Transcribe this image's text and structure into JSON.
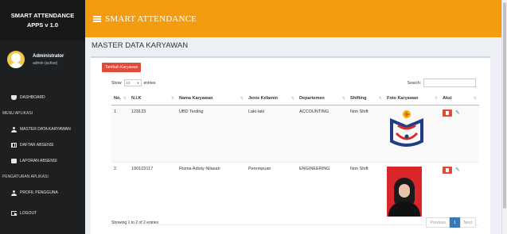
{
  "sidebar": {
    "brand_line1": "SMART ATTENDANCE",
    "brand_line2": "APPS v 1.0",
    "user_name": "Administrator",
    "user_status": "admin (active)",
    "items": [
      {
        "label": "DASHBOARD",
        "icon": "dashboard-icon"
      },
      {
        "label": "MENU APLIKASI",
        "header": true
      },
      {
        "label": "MASTER DATA KARYAWAN",
        "icon": "users-icon"
      },
      {
        "label": "DAFTAR ABSENSI",
        "icon": "table-icon"
      },
      {
        "label": "LAPORAN ABSENSI",
        "icon": "book-icon"
      },
      {
        "label": "PENGATURAN APLIKASI",
        "header": true
      },
      {
        "label": "PROFIL PENGGUNA",
        "icon": "user-icon"
      },
      {
        "label": "LOGOUT",
        "icon": "sign-out-icon"
      }
    ]
  },
  "topbar": {
    "title": "SMART ATTENDANCE"
  },
  "page": {
    "title": "MASTER DATA KARYAWAN"
  },
  "toolbar": {
    "add_label": "Tambah Karyawan",
    "show_label": "Show",
    "entries_value": "10",
    "entries_label": "entries",
    "search_label": "Search:"
  },
  "table": {
    "headers": [
      "No.",
      "N.I.K",
      "Nama Karyawan",
      "Jenis Kelamin",
      "Departemen",
      "Shifting",
      "Foto Karyawan",
      "Aksi"
    ],
    "rows": [
      {
        "no": "1",
        "nik": "123123",
        "nama": "UBD Testing",
        "jk": "Laki-laki",
        "dept": "ACCOUNTING",
        "shift": "Non Shift",
        "photo": "logo"
      },
      {
        "no": "2",
        "nik": "190103117",
        "nama": "Risma Adisty Nilasari",
        "jk": "Perempuan",
        "dept": "ENGINEERING",
        "shift": "Non Shift",
        "photo": "person"
      }
    ]
  },
  "footer": {
    "info": "Showing 1 to 2 of 2 entries",
    "prev": "Previous",
    "page": "1",
    "next": "Next"
  },
  "colors": {
    "topbar": "#f39c12",
    "sidebar": "#1d1f21",
    "danger": "#dd4b39",
    "primary": "#337ab7"
  }
}
